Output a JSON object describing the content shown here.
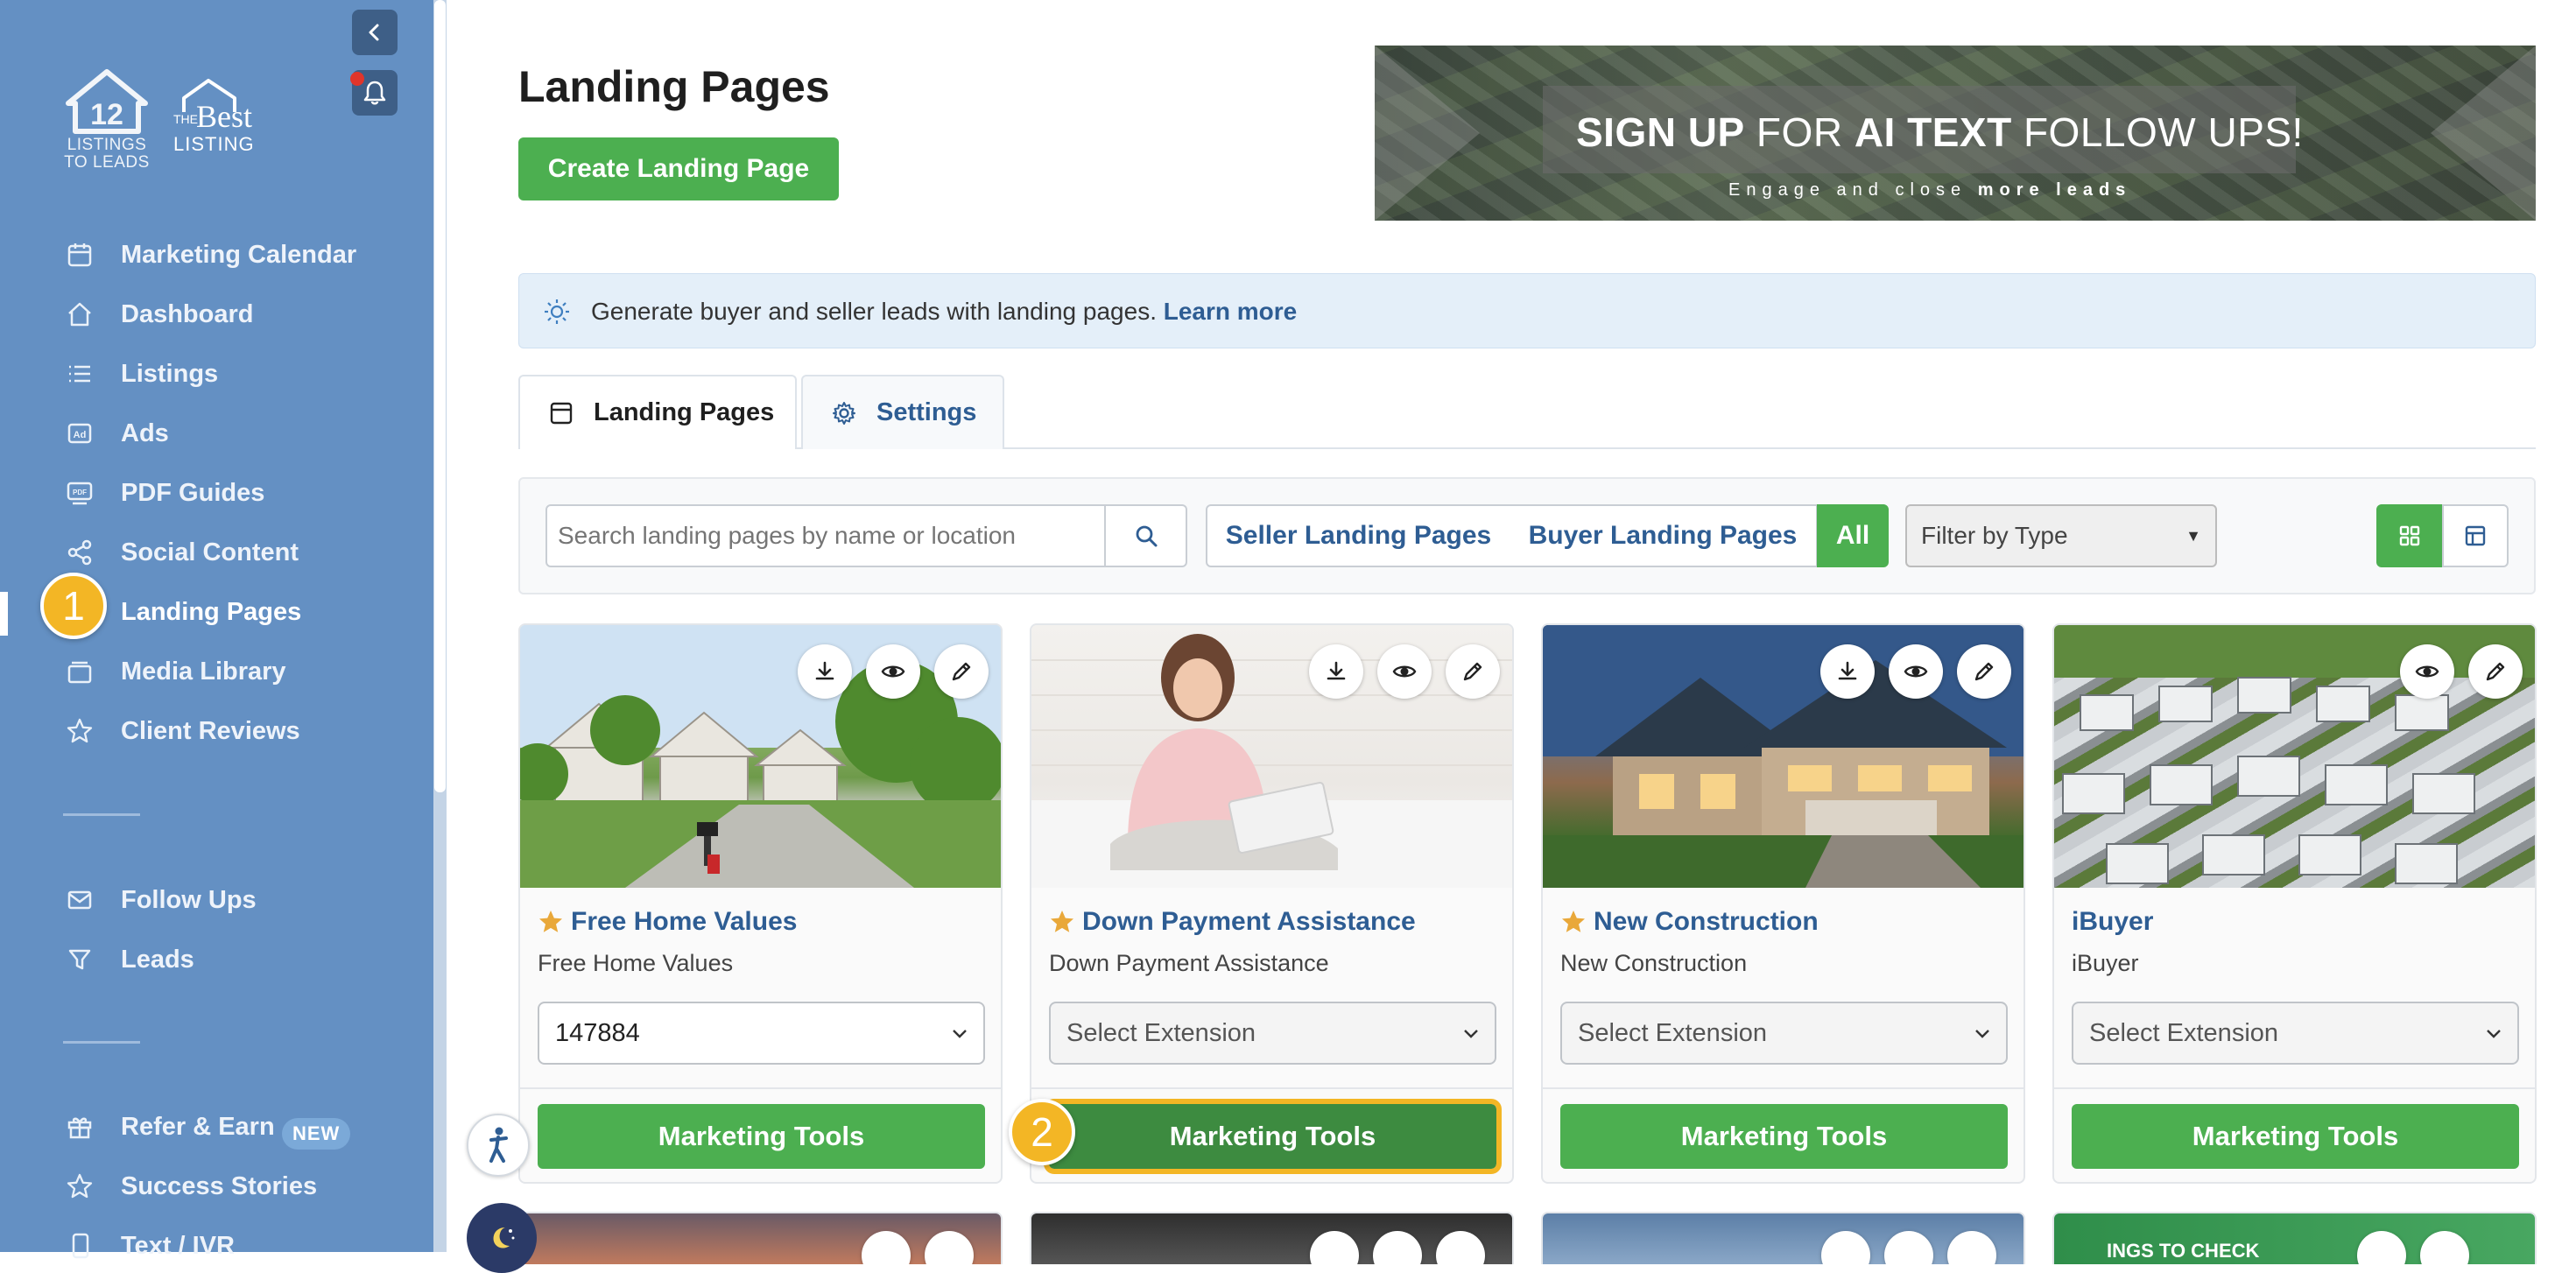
{
  "app": {
    "logo_primary_text": "LISTINGS\nTO LEADS",
    "logo_secondary_small": "THE",
    "logo_secondary_best": "Best",
    "logo_secondary_listing": "LISTING"
  },
  "sidebar": {
    "items": [
      {
        "label": "Marketing Calendar",
        "icon": "calendar-icon"
      },
      {
        "label": "Dashboard",
        "icon": "home-icon"
      },
      {
        "label": "Listings",
        "icon": "list-icon"
      },
      {
        "label": "Ads",
        "icon": "ad-icon"
      },
      {
        "label": "PDF Guides",
        "icon": "pdf-icon"
      },
      {
        "label": "Social Content",
        "icon": "share-icon"
      },
      {
        "label": "Landing Pages",
        "icon": "landing-page-icon",
        "active": true
      },
      {
        "label": "Media Library",
        "icon": "folder-icon"
      },
      {
        "label": "Client Reviews",
        "icon": "star-icon"
      },
      {
        "label": "Follow Ups",
        "icon": "mail-icon"
      },
      {
        "label": "Leads",
        "icon": "filter-icon"
      },
      {
        "label": "Refer & Earn",
        "icon": "gift-icon"
      },
      {
        "label": "Success Stories",
        "icon": "star-icon"
      },
      {
        "label": "Text / IVR",
        "icon": "phone-icon"
      }
    ],
    "new_badge": "NEW"
  },
  "steps": {
    "one": "1",
    "two": "2"
  },
  "main": {
    "title": "Landing Pages",
    "create_button": "Create Landing Page",
    "promo": {
      "part1": "SIGN UP",
      "part2": " FOR ",
      "part3": "AI TEXT",
      "part4": " FOLLOW UPS!",
      "sub_plain": "Engage and close ",
      "sub_bold": "more leads"
    },
    "info": {
      "text": "Generate buyer and seller leads with landing pages. ",
      "link": "Learn more"
    },
    "tabs": [
      {
        "label": "Landing Pages"
      },
      {
        "label": "Settings"
      }
    ],
    "filters": {
      "search_placeholder": "Search landing pages by name or location",
      "seller": "Seller Landing Pages",
      "buyer": "Buyer Landing Pages",
      "all": "All",
      "type_select": "Filter by Type"
    }
  },
  "cards": [
    {
      "title": "Free Home Values",
      "subtitle": "Free Home Values",
      "extension": "147884",
      "button": "Marketing Tools",
      "starred": true
    },
    {
      "title": "Down Payment Assistance",
      "subtitle": "Down Payment Assistance",
      "extension": "Select Extension",
      "button": "Marketing Tools",
      "starred": true
    },
    {
      "title": "New Construction",
      "subtitle": "New Construction",
      "extension": "Select Extension",
      "button": "Marketing Tools",
      "starred": true
    },
    {
      "title": "iBuyer",
      "subtitle": "iBuyer",
      "extension": "Select Extension",
      "button": "Marketing Tools",
      "starred": false
    }
  ],
  "row2_partial_text": "INGS TO CHECK"
}
